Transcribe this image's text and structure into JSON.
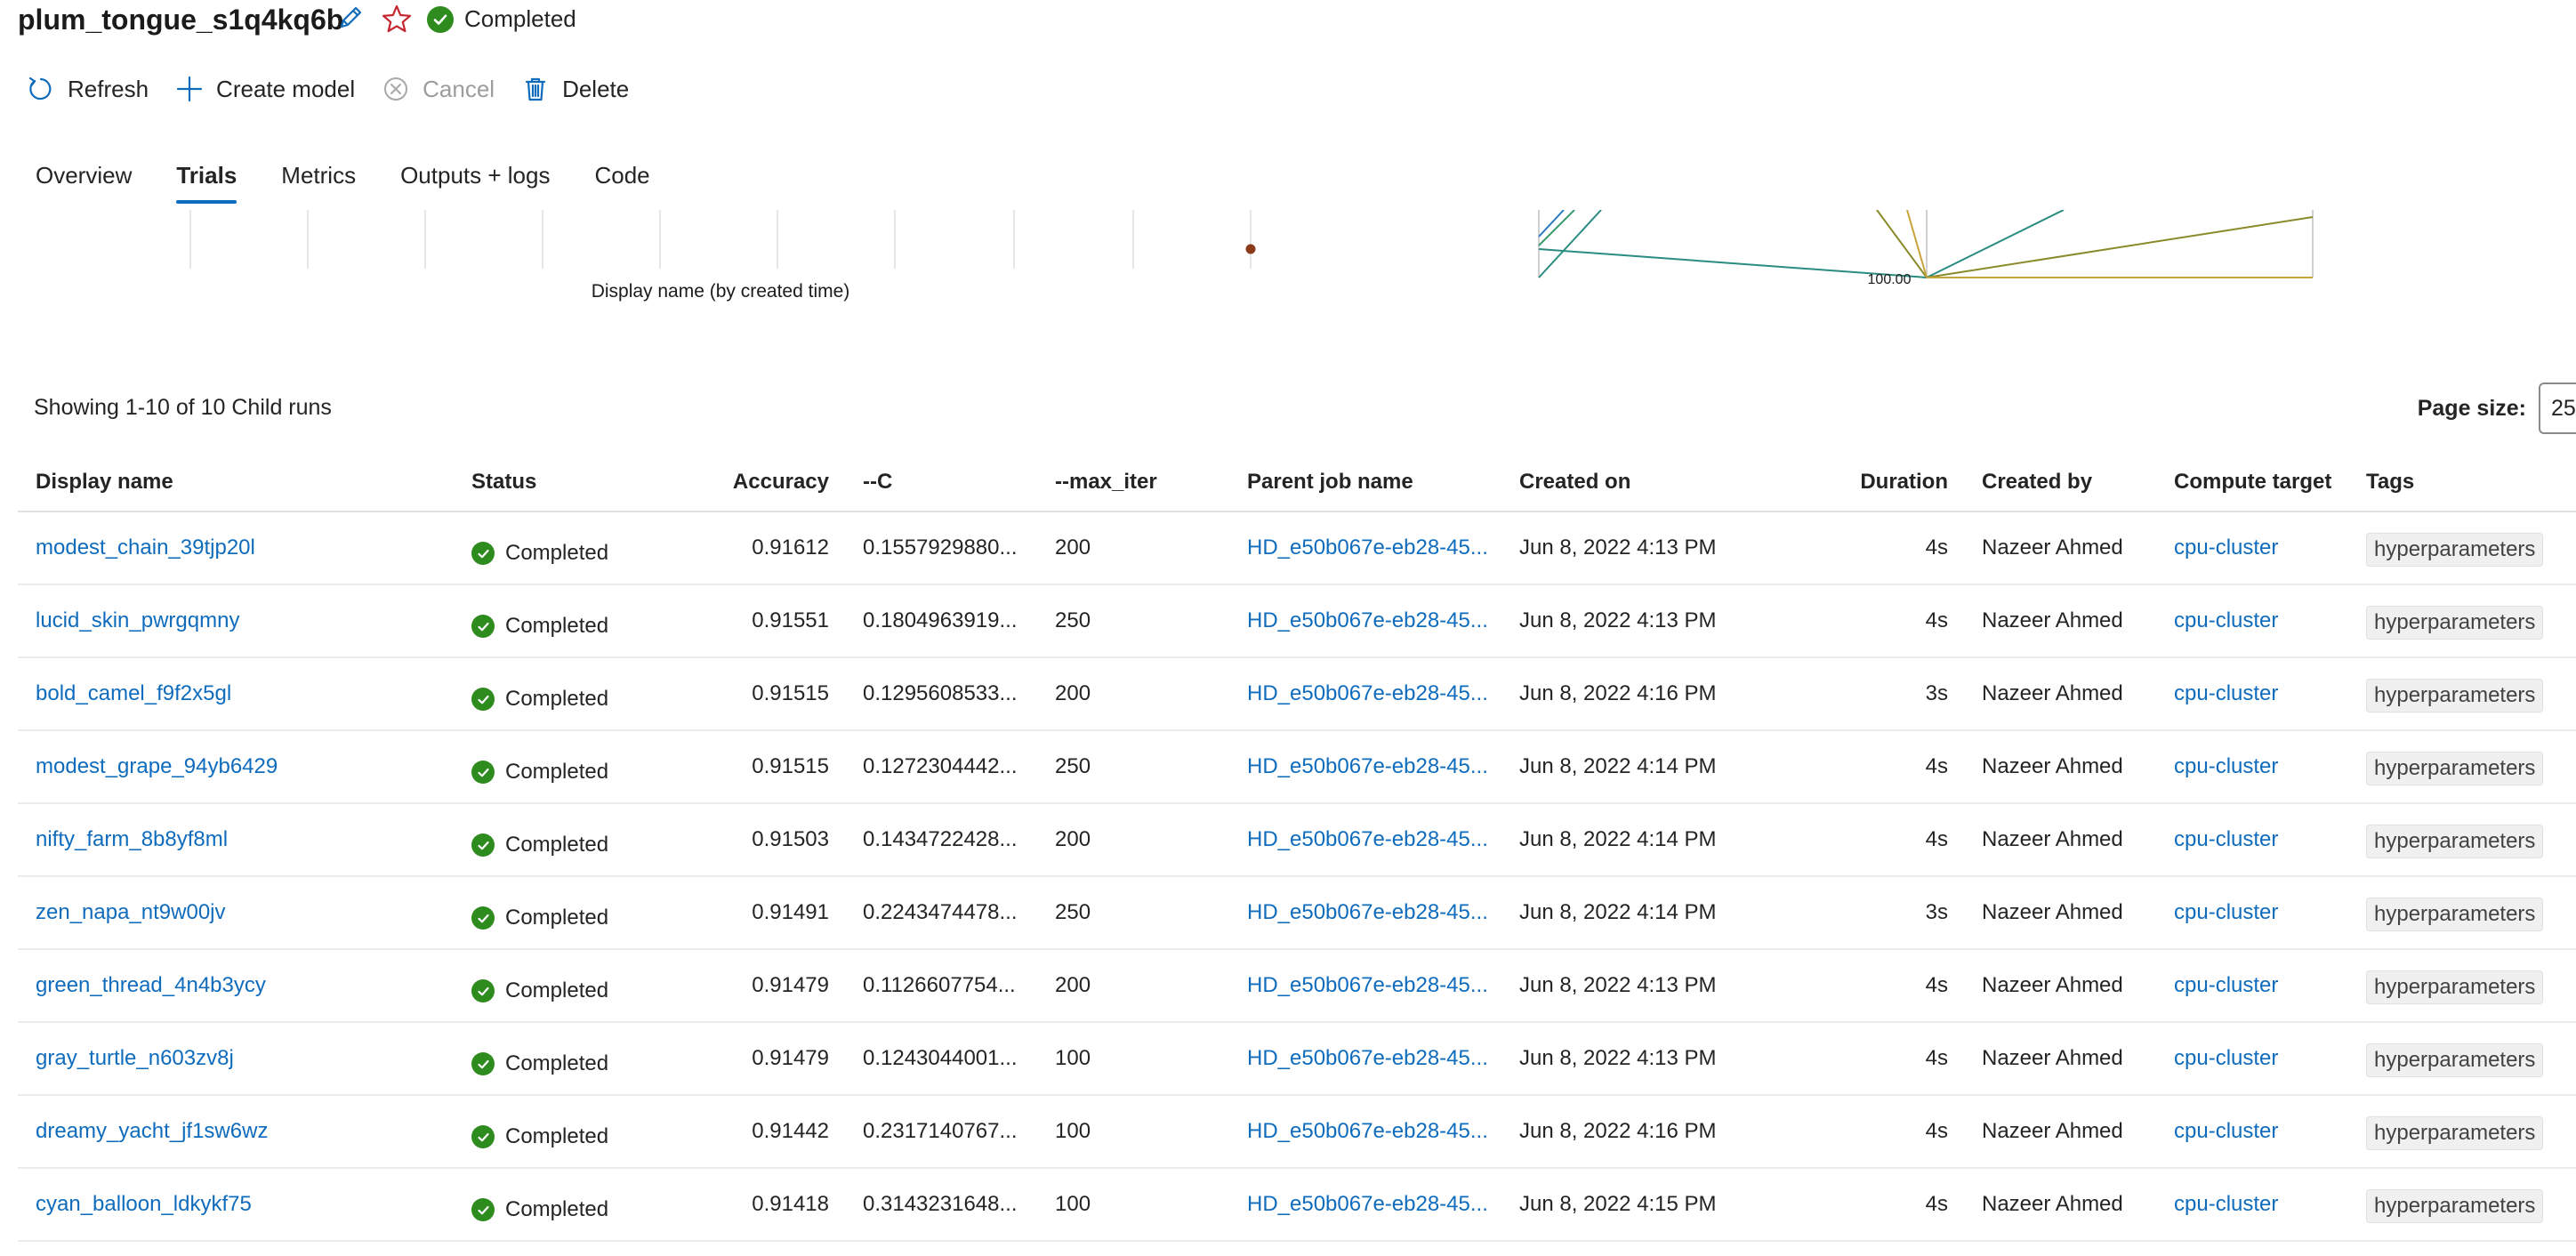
{
  "header": {
    "title": "plum_tongue_s1q4kq6b",
    "status": "Completed"
  },
  "toolbar": {
    "refresh": "Refresh",
    "create_model": "Create model",
    "cancel": "Cancel",
    "delete": "Delete"
  },
  "tabs": [
    {
      "label": "Overview",
      "active": false
    },
    {
      "label": "Trials",
      "active": true
    },
    {
      "label": "Metrics",
      "active": false
    },
    {
      "label": "Outputs + logs",
      "active": false
    },
    {
      "label": "Code",
      "active": false
    }
  ],
  "charts": {
    "scatter_xlabel": "Display name (by created time)",
    "parallel_tick_label": "100.00",
    "colors": {
      "point": "#8b3a1a",
      "teal": "#2a8c80",
      "olive": "#8a8a2a",
      "gold": "#c9a43a",
      "blue": "#2a7ac0",
      "green": "#3a9a6a"
    }
  },
  "runs_table": {
    "count_text": "Showing 1-10 of 10 Child runs",
    "page_size_label": "Page size:",
    "page_size_value": "25",
    "columns": [
      "Display name",
      "Status",
      "Accuracy",
      "--C",
      "--max_iter",
      "Parent job name",
      "Created on",
      "Duration",
      "Created by",
      "Compute target",
      "Tags"
    ],
    "rows": [
      {
        "name": "modest_chain_39tjp20l",
        "status": "Completed",
        "accuracy": "0.91612",
        "c": "0.1557929880...",
        "max_iter": "200",
        "parent": "HD_e50b067e-eb28-45...",
        "created": "Jun 8, 2022 4:13 PM",
        "duration": "4s",
        "by": "Nazeer Ahmed",
        "target": "cpu-cluster",
        "tag": "hyperparameters"
      },
      {
        "name": "lucid_skin_pwrgqmny",
        "status": "Completed",
        "accuracy": "0.91551",
        "c": "0.1804963919...",
        "max_iter": "250",
        "parent": "HD_e50b067e-eb28-45...",
        "created": "Jun 8, 2022 4:13 PM",
        "duration": "4s",
        "by": "Nazeer Ahmed",
        "target": "cpu-cluster",
        "tag": "hyperparameters"
      },
      {
        "name": "bold_camel_f9f2x5gl",
        "status": "Completed",
        "accuracy": "0.91515",
        "c": "0.1295608533...",
        "max_iter": "200",
        "parent": "HD_e50b067e-eb28-45...",
        "created": "Jun 8, 2022 4:16 PM",
        "duration": "3s",
        "by": "Nazeer Ahmed",
        "target": "cpu-cluster",
        "tag": "hyperparameters"
      },
      {
        "name": "modest_grape_94yb6429",
        "status": "Completed",
        "accuracy": "0.91515",
        "c": "0.1272304442...",
        "max_iter": "250",
        "parent": "HD_e50b067e-eb28-45...",
        "created": "Jun 8, 2022 4:14 PM",
        "duration": "4s",
        "by": "Nazeer Ahmed",
        "target": "cpu-cluster",
        "tag": "hyperparameters"
      },
      {
        "name": "nifty_farm_8b8yf8ml",
        "status": "Completed",
        "accuracy": "0.91503",
        "c": "0.1434722428...",
        "max_iter": "200",
        "parent": "HD_e50b067e-eb28-45...",
        "created": "Jun 8, 2022 4:14 PM",
        "duration": "4s",
        "by": "Nazeer Ahmed",
        "target": "cpu-cluster",
        "tag": "hyperparameters"
      },
      {
        "name": "zen_napa_nt9w00jv",
        "status": "Completed",
        "accuracy": "0.91491",
        "c": "0.2243474478...",
        "max_iter": "250",
        "parent": "HD_e50b067e-eb28-45...",
        "created": "Jun 8, 2022 4:14 PM",
        "duration": "3s",
        "by": "Nazeer Ahmed",
        "target": "cpu-cluster",
        "tag": "hyperparameters"
      },
      {
        "name": "green_thread_4n4b3ycy",
        "status": "Completed",
        "accuracy": "0.91479",
        "c": "0.1126607754...",
        "max_iter": "200",
        "parent": "HD_e50b067e-eb28-45...",
        "created": "Jun 8, 2022 4:13 PM",
        "duration": "4s",
        "by": "Nazeer Ahmed",
        "target": "cpu-cluster",
        "tag": "hyperparameters"
      },
      {
        "name": "gray_turtle_n603zv8j",
        "status": "Completed",
        "accuracy": "0.91479",
        "c": "0.1243044001...",
        "max_iter": "100",
        "parent": "HD_e50b067e-eb28-45...",
        "created": "Jun 8, 2022 4:13 PM",
        "duration": "4s",
        "by": "Nazeer Ahmed",
        "target": "cpu-cluster",
        "tag": "hyperparameters"
      },
      {
        "name": "dreamy_yacht_jf1sw6wz",
        "status": "Completed",
        "accuracy": "0.91442",
        "c": "0.2317140767...",
        "max_iter": "100",
        "parent": "HD_e50b067e-eb28-45...",
        "created": "Jun 8, 2022 4:16 PM",
        "duration": "4s",
        "by": "Nazeer Ahmed",
        "target": "cpu-cluster",
        "tag": "hyperparameters"
      },
      {
        "name": "cyan_balloon_ldkykf75",
        "status": "Completed",
        "accuracy": "0.91418",
        "c": "0.3143231648...",
        "max_iter": "100",
        "parent": "HD_e50b067e-eb28-45...",
        "created": "Jun 8, 2022 4:15 PM",
        "duration": "4s",
        "by": "Nazeer Ahmed",
        "target": "cpu-cluster",
        "tag": "hyperparameters"
      }
    ]
  }
}
